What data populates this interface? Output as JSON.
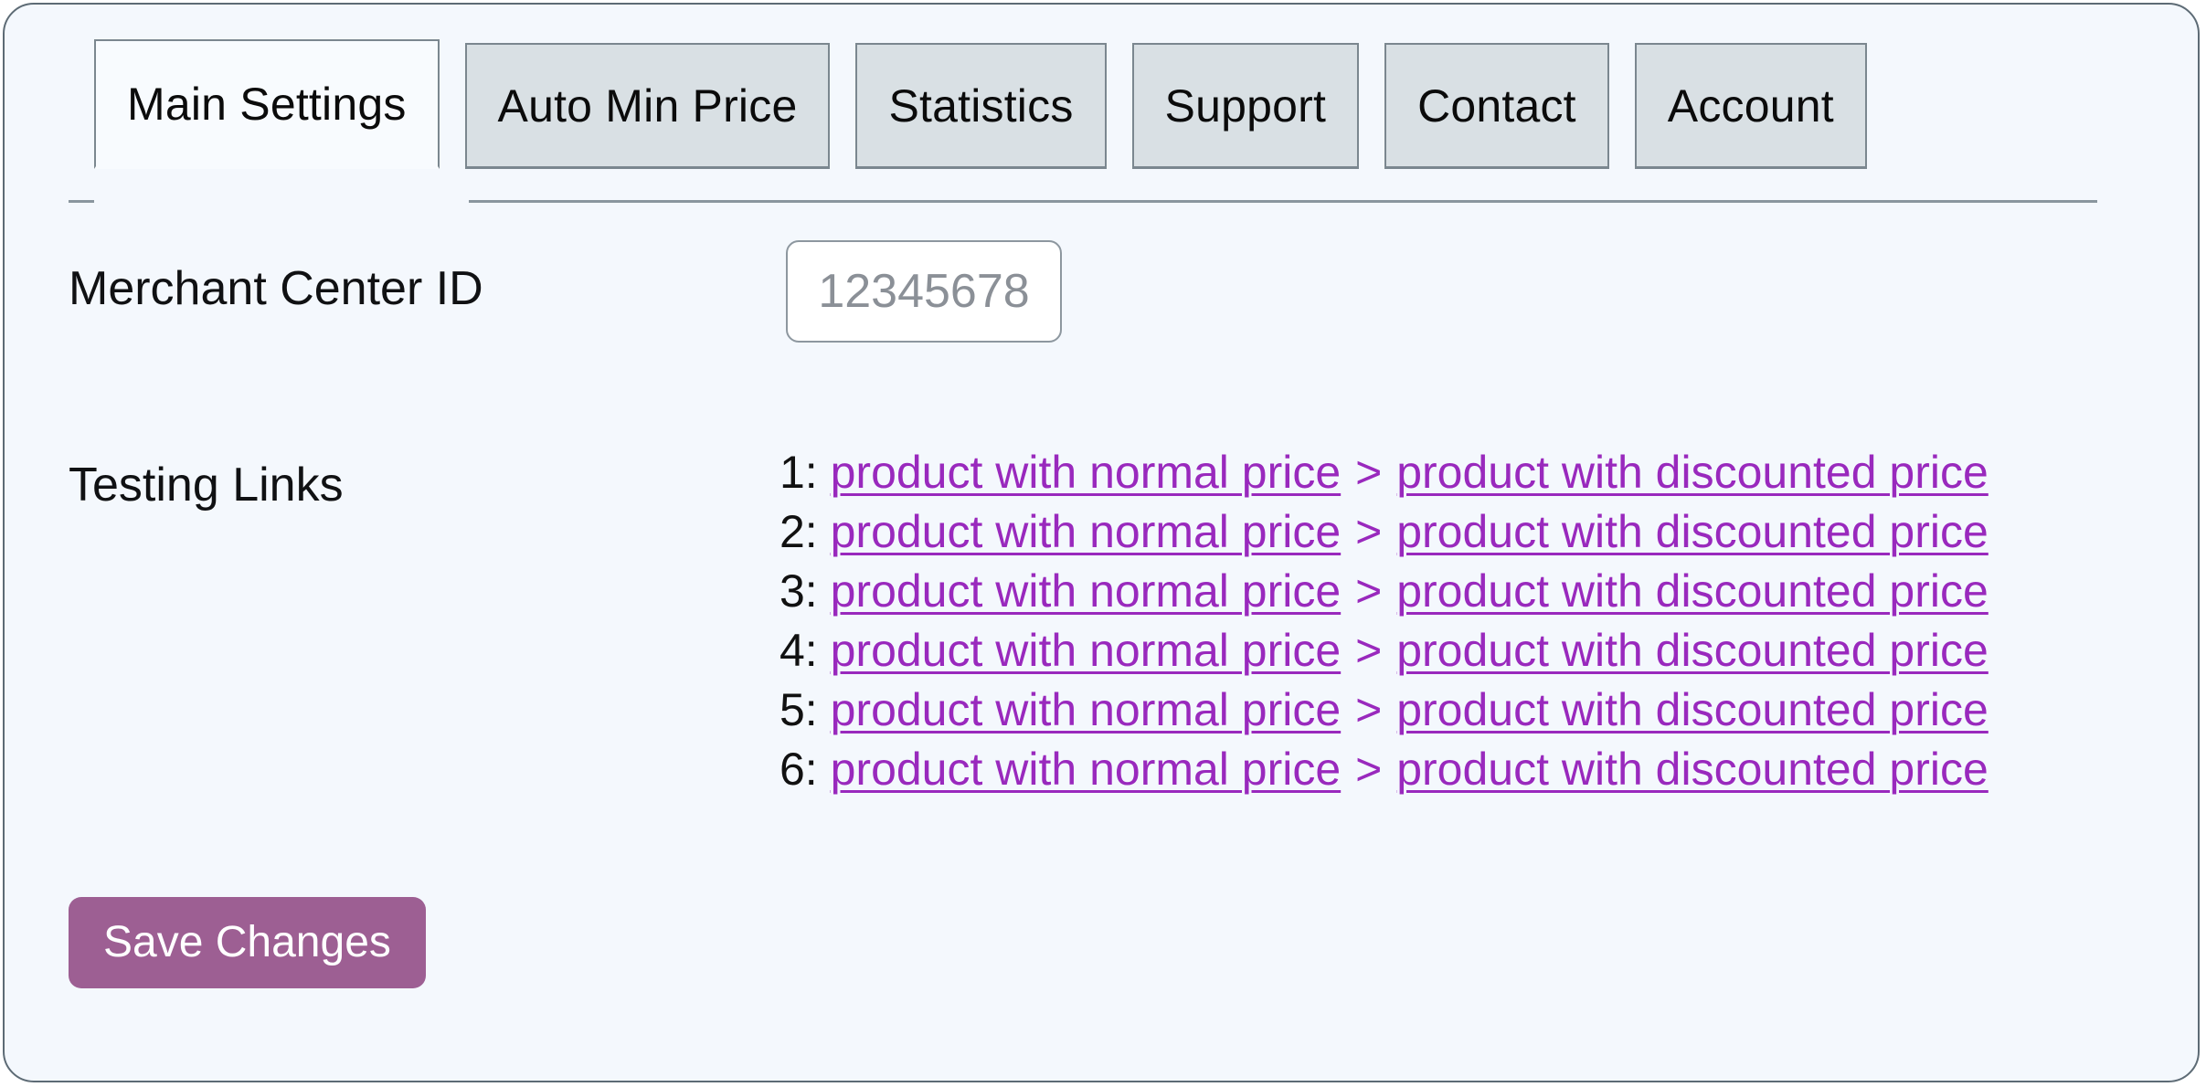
{
  "panel": {
    "accent_color": "#9d5f93",
    "link_color": "#9929bd",
    "background": "#f4f8fd"
  },
  "tabs": [
    {
      "label": "Main Settings",
      "active": true
    },
    {
      "label": "Auto Min Price",
      "active": false
    },
    {
      "label": "Statistics",
      "active": false
    },
    {
      "label": "Support",
      "active": false
    },
    {
      "label": "Contact",
      "active": false
    },
    {
      "label": "Account",
      "active": false
    }
  ],
  "form": {
    "merchant_center": {
      "label": "Merchant Center ID",
      "value": "",
      "placeholder": "12345678"
    },
    "testing_links": {
      "label": "Testing Links",
      "separator": ">",
      "rows": [
        {
          "num": "1:",
          "normal": "product with normal price",
          "discounted": "product with discounted price"
        },
        {
          "num": "2:",
          "normal": "product with normal price",
          "discounted": "product with discounted price"
        },
        {
          "num": "3:",
          "normal": "product with normal price",
          "discounted": "product with discounted price"
        },
        {
          "num": "4:",
          "normal": "product with normal price",
          "discounted": "product with discounted price"
        },
        {
          "num": "5:",
          "normal": "product with normal price",
          "discounted": "product with discounted price"
        },
        {
          "num": "6:",
          "normal": "product with normal price",
          "discounted": "product with discounted price"
        }
      ]
    },
    "save_label": "Save Changes"
  }
}
